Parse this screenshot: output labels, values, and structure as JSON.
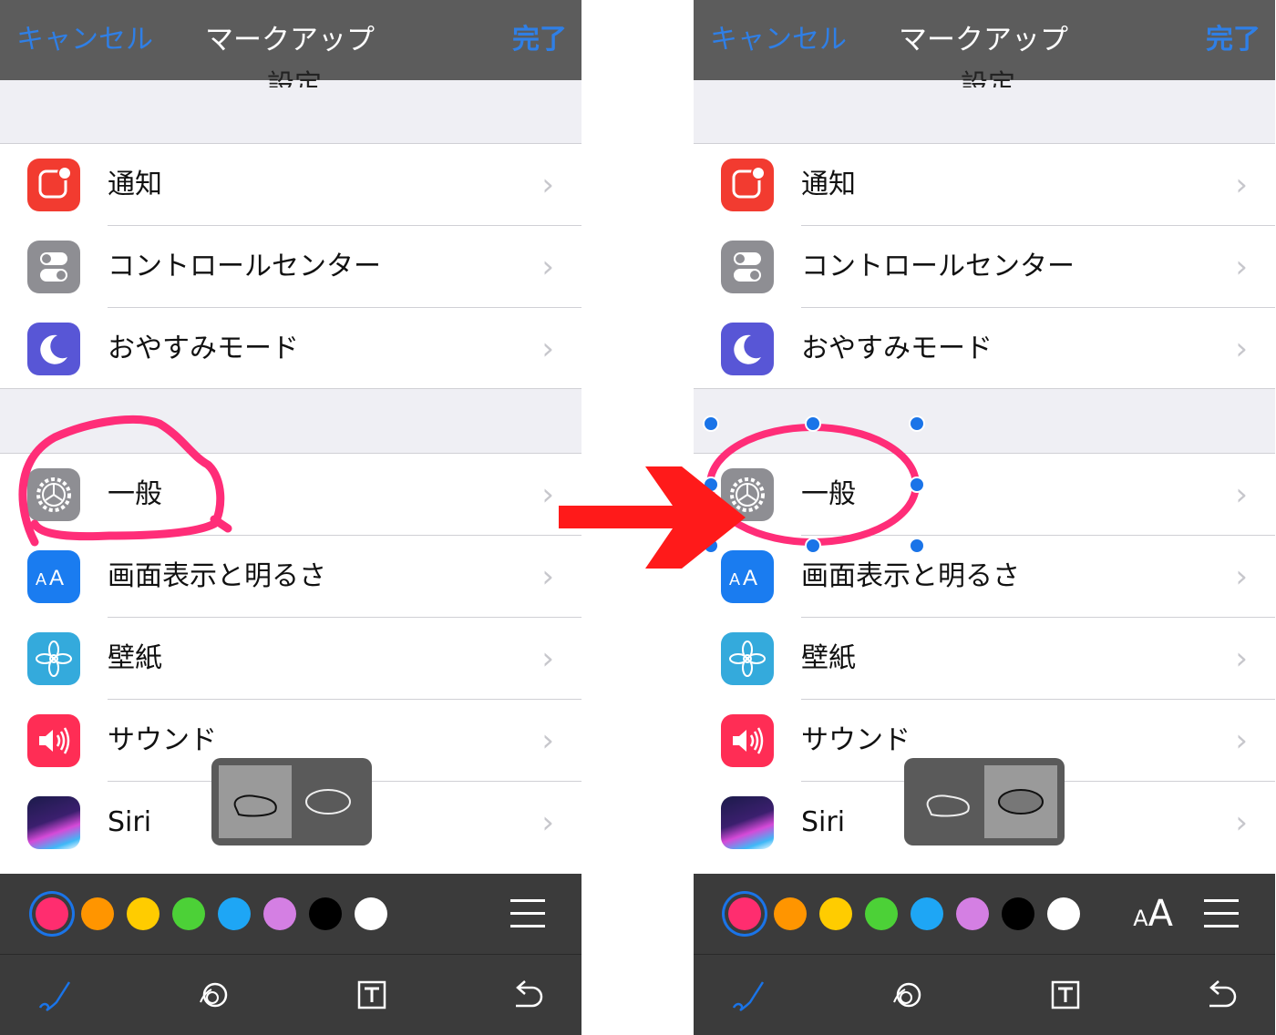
{
  "navbar": {
    "cancel": "キャンセル",
    "title": "マークアップ",
    "done": "完了"
  },
  "behind_title": "設定",
  "group1": [
    {
      "label": "通知",
      "icon": "notifications-icon",
      "color": "#f23b30"
    },
    {
      "label": "コントロールセンター",
      "icon": "control-center-icon",
      "color": "#8e8e93"
    },
    {
      "label": "おやすみモード",
      "icon": "moon-icon",
      "color": "#5856d6"
    }
  ],
  "group2": [
    {
      "label": "一般",
      "icon": "gear-icon",
      "color": "#8e8e93"
    },
    {
      "label": "画面表示と明るさ",
      "icon": "text-size-icon",
      "color": "#1a7cf0"
    },
    {
      "label": "壁紙",
      "icon": "flower-icon",
      "color": "#34aadc"
    },
    {
      "label": "サウンド",
      "icon": "speaker-icon",
      "color": "#ff2d55"
    },
    {
      "label": "Siri",
      "icon": "siri-icon",
      "color": "#2a2a6a"
    }
  ],
  "colors": [
    "#ff2d6f",
    "#ff9500",
    "#ffcc00",
    "#4cd137",
    "#1ea6f5",
    "#d47fe3",
    "#000000",
    "#ffffff"
  ],
  "selected_color": "#ff2d6f",
  "text_size_glyph": {
    "small": "A",
    "large": "A"
  },
  "tools": [
    "pen-tool-icon",
    "magnifier-tool-icon",
    "text-tool-icon",
    "undo-icon"
  ],
  "shape_popup": {
    "left_panel_selected": "freeform-shape",
    "right_panel_selected": "oval-shape"
  },
  "transition_arrow_color": "#ff1a1a",
  "annotation_color": "#ff2d78",
  "handle_color": "#1a74e8"
}
